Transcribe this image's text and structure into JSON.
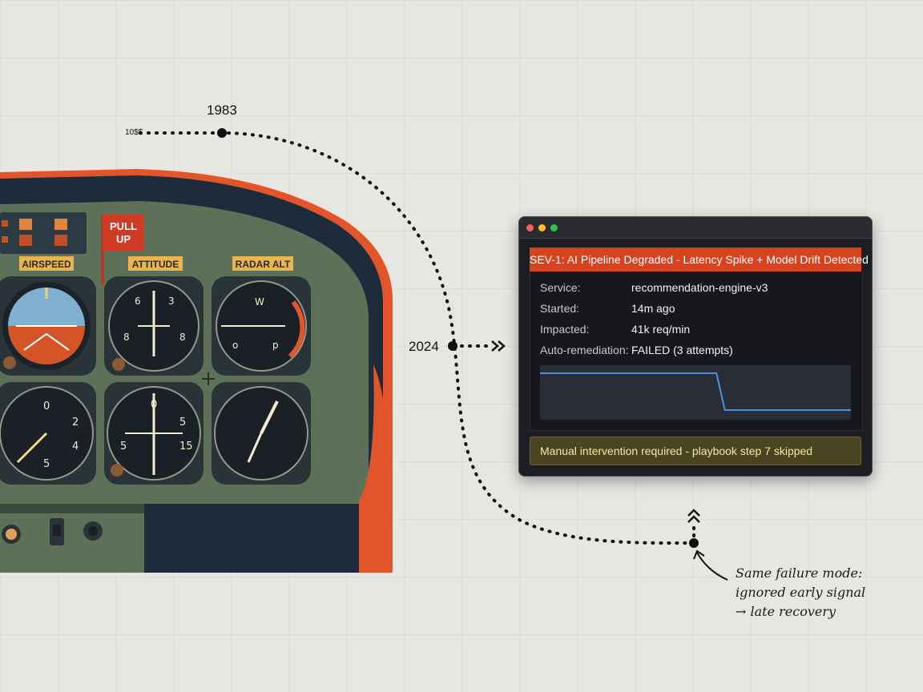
{
  "timeline": {
    "year_1983": "1983",
    "year_2024": "2024",
    "start_label": "10$$"
  },
  "cockpit": {
    "warning": {
      "line1": "PULL",
      "line2": "UP"
    },
    "gauges": [
      {
        "label": "AIRSPEED"
      },
      {
        "label": "ATTITUDE"
      },
      {
        "label": "RADAR ALT"
      }
    ],
    "colors": {
      "frame": "#1d2b3a",
      "panel": "#5d7058",
      "accent": "#e2542a",
      "label_bg": "#eab54e"
    }
  },
  "incident": {
    "title": "SEV-1: AI Pipeline Degraded - Latency Spike + Model Drift Detected",
    "fields": [
      {
        "key": "Service:",
        "value": "recommendation-engine-v3"
      },
      {
        "key": "Started:",
        "value": "14m ago"
      },
      {
        "key": "Impacted:",
        "value": "41k req/min"
      },
      {
        "key": "Auto-remediation:",
        "value": "FAILED (3 attempts)"
      }
    ],
    "sparkline_values": [
      1,
      1,
      1,
      1,
      1,
      1,
      1,
      1,
      1,
      1,
      1,
      1,
      1,
      1,
      1,
      1,
      1,
      1,
      1,
      1,
      1,
      1,
      0.2,
      0.2,
      0.2,
      0.2,
      0.2,
      0.2,
      0.2,
      0.2,
      0.2,
      0.2,
      0.2,
      0.2,
      0.2,
      0.2,
      0.2,
      0.2
    ],
    "warning": "Manual intervention required - playbook step 7 skipped",
    "colors": {
      "banner": "#d9421f",
      "line": "#4a8fe0",
      "warning_bg": "#4a4420",
      "warning_text": "#f3e7a4"
    },
    "window_controls": [
      "close-dot",
      "minimize-dot",
      "zoom-dot"
    ]
  },
  "annotation": {
    "lines": [
      "Same failure mode:",
      "ignored early signal",
      "→ late recovery"
    ]
  }
}
